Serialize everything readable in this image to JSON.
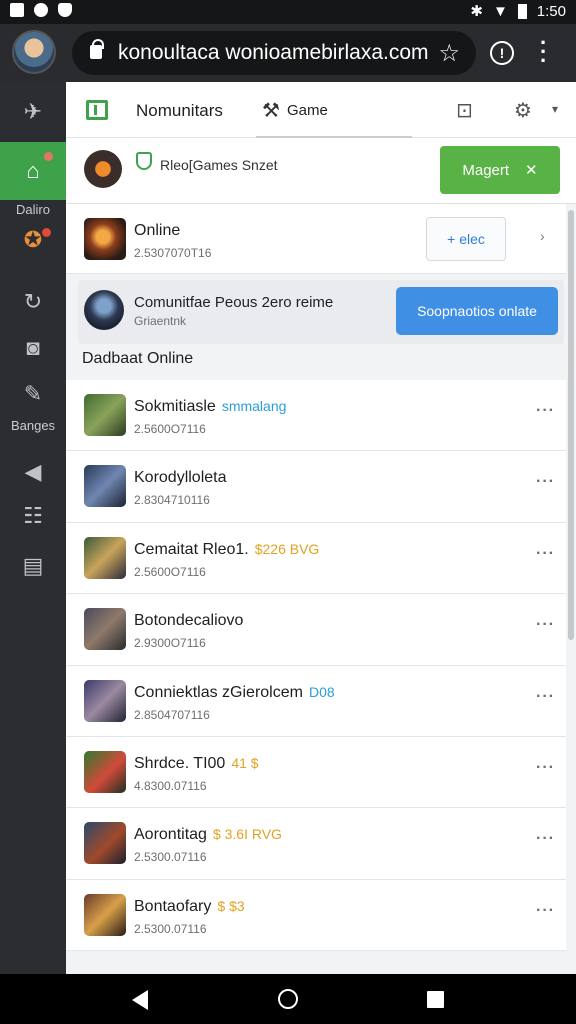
{
  "status": {
    "time": "1:50"
  },
  "browser": {
    "url": "konoultaca wonioamebirlaxa.com"
  },
  "sidebar": {
    "label_top": "Daliro",
    "label_mid": "Banges"
  },
  "tabs": {
    "tab1": "Nomunitars",
    "tab2": "Game"
  },
  "banner": {
    "title": "Rleo[Games Snzet",
    "button": "Magert"
  },
  "online": {
    "title": "Online",
    "sub": "2.5307070T16",
    "button": "+ elec"
  },
  "community": {
    "title": "Comunitfae  Peous 2ero  reime",
    "sub": "Griaentnk",
    "button": "Soopnaotios onlate"
  },
  "section": {
    "title": "Dadbaat Online"
  },
  "list": [
    {
      "title": "Sokmitiasle",
      "tag": "smmalang",
      "tag_color": "#2a9fd8",
      "sub": "2.5600O7116"
    },
    {
      "title": "Korodylloleta",
      "tag": "",
      "tag_color": "#2a9fd8",
      "sub": "2.8304710116"
    },
    {
      "title": "Cemaitat Rleo1.",
      "tag": "$226 BVG",
      "tag_color": "#e2a21f",
      "sub": "2.5600O7116"
    },
    {
      "title": "Botondecaliovo",
      "tag": "",
      "tag_color": "#2a9fd8",
      "sub": "2.9300O7116"
    },
    {
      "title": "Conniektlas zGierolcem",
      "tag": "D08",
      "tag_color": "#2a9fd8",
      "sub": "2.8504707116"
    },
    {
      "title": "Shrdce. TI00",
      "tag": "41 $",
      "tag_color": "#e2a21f",
      "sub": "4.8300.07116"
    },
    {
      "title": "Aorontitag",
      "tag": "$ 3.6I RVG",
      "tag_color": "#e2a21f",
      "sub": "2.5300.07116"
    },
    {
      "title": "Bontaofary",
      "tag": "$ $3",
      "tag_color": "#e2a21f",
      "sub": "2.5300.07116"
    }
  ],
  "colors": {
    "accent_green": "#3da24a",
    "accent_blue": "#3f8fe4"
  }
}
